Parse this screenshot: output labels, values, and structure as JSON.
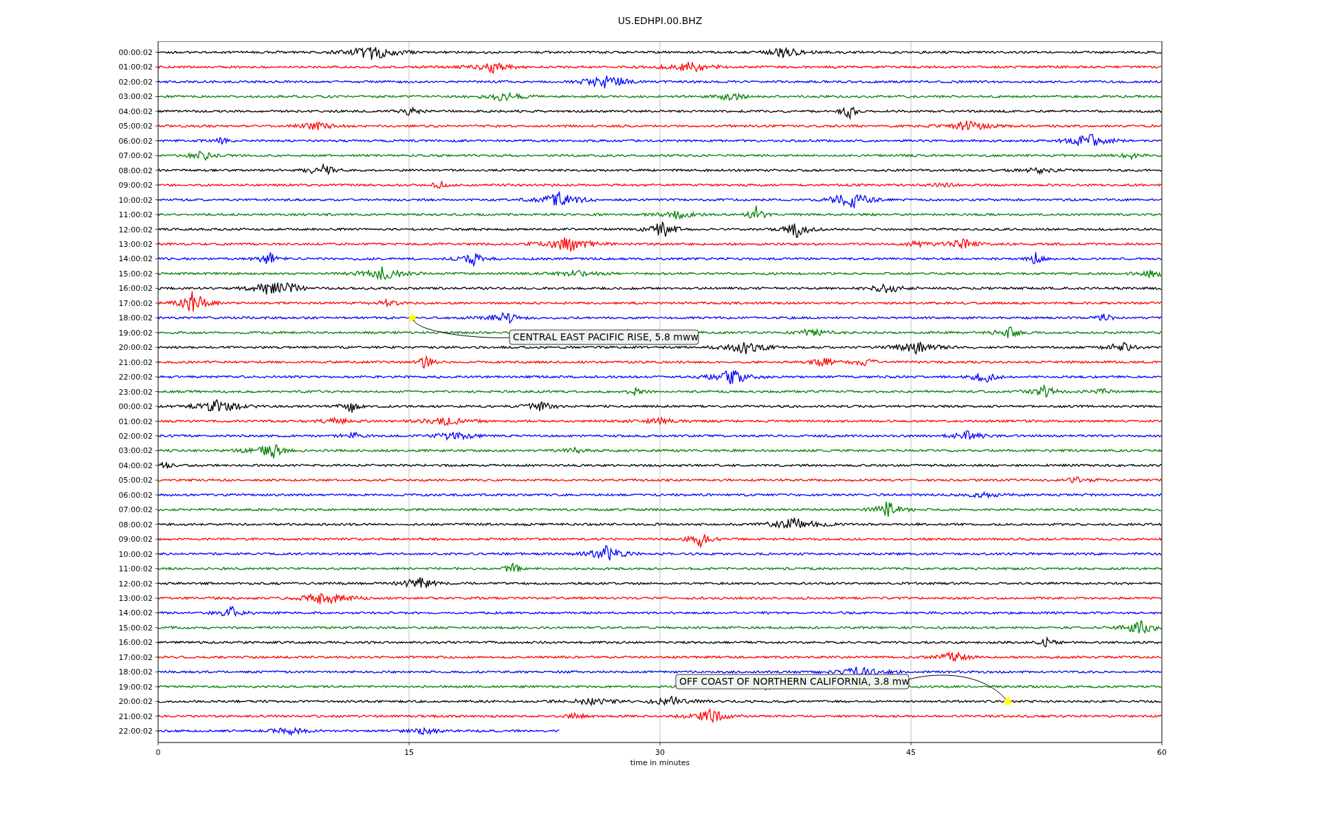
{
  "title": "US.EDHPI.00.BHZ",
  "xlabel": "time in minutes",
  "xticks": [
    "0",
    "15",
    "30",
    "45",
    "60"
  ],
  "rows": [
    {
      "label": "00:00:02",
      "color": "#000000",
      "level": 1
    },
    {
      "label": "01:00:02",
      "color": "#ff0000",
      "level": 1
    },
    {
      "label": "02:00:02",
      "color": "#0000ff",
      "level": 1
    },
    {
      "label": "03:00:02",
      "color": "#008000",
      "level": 1
    },
    {
      "label": "04:00:02",
      "color": "#000000",
      "level": 1
    },
    {
      "label": "05:00:02",
      "color": "#ff0000",
      "level": 1
    },
    {
      "label": "06:00:02",
      "color": "#0000ff",
      "level": 1
    },
    {
      "label": "07:00:02",
      "color": "#008000",
      "level": 1
    },
    {
      "label": "08:00:02",
      "color": "#000000",
      "level": 1
    },
    {
      "label": "09:00:02",
      "color": "#ff0000",
      "level": 1
    },
    {
      "label": "10:00:02",
      "color": "#0000ff",
      "level": 1
    },
    {
      "label": "11:00:02",
      "color": "#008000",
      "level": 1
    },
    {
      "label": "12:00:02",
      "color": "#000000",
      "level": 1
    },
    {
      "label": "13:00:02",
      "color": "#ff0000",
      "level": 1
    },
    {
      "label": "14:00:02",
      "color": "#0000ff",
      "level": 1
    },
    {
      "label": "15:00:02",
      "color": "#008000",
      "level": 1
    },
    {
      "label": "16:00:02",
      "color": "#000000",
      "level": 1
    },
    {
      "label": "17:00:02",
      "color": "#ff0000",
      "level": 1
    },
    {
      "label": "18:00:02",
      "color": "#0000ff",
      "level": 1
    },
    {
      "label": "19:00:02",
      "color": "#008000",
      "level": 1
    },
    {
      "label": "20:00:02",
      "color": "#000000",
      "level": 1
    },
    {
      "label": "21:00:02",
      "color": "#ff0000",
      "level": 1
    },
    {
      "label": "22:00:02",
      "color": "#0000ff",
      "level": 1
    },
    {
      "label": "23:00:02",
      "color": "#008000",
      "level": 1
    },
    {
      "label": "00:00:02",
      "color": "#000000",
      "level": 1
    },
    {
      "label": "01:00:02",
      "color": "#ff0000",
      "level": 1
    },
    {
      "label": "02:00:02",
      "color": "#0000ff",
      "level": 1
    },
    {
      "label": "03:00:02",
      "color": "#008000",
      "level": 1
    },
    {
      "label": "04:00:02",
      "color": "#000000",
      "level": 1
    },
    {
      "label": "05:00:02",
      "color": "#ff0000",
      "level": 1
    },
    {
      "label": "06:00:02",
      "color": "#0000ff",
      "level": 1
    },
    {
      "label": "07:00:02",
      "color": "#008000",
      "level": 1
    },
    {
      "label": "08:00:02",
      "color": "#000000",
      "level": 1
    },
    {
      "label": "09:00:02",
      "color": "#ff0000",
      "level": 1
    },
    {
      "label": "10:00:02",
      "color": "#0000ff",
      "level": 1
    },
    {
      "label": "11:00:02",
      "color": "#008000",
      "level": 1
    },
    {
      "label": "12:00:02",
      "color": "#000000",
      "level": 1
    },
    {
      "label": "13:00:02",
      "color": "#ff0000",
      "level": 1
    },
    {
      "label": "14:00:02",
      "color": "#0000ff",
      "level": 1
    },
    {
      "label": "15:00:02",
      "color": "#008000",
      "level": 1
    },
    {
      "label": "16:00:02",
      "color": "#000000",
      "level": 1
    },
    {
      "label": "17:00:02",
      "color": "#ff0000",
      "level": 1
    },
    {
      "label": "18:00:02",
      "color": "#0000ff",
      "level": 1
    },
    {
      "label": "19:00:02",
      "color": "#008000",
      "level": 1
    },
    {
      "label": "20:00:02",
      "color": "#000000",
      "level": 1
    },
    {
      "label": "21:00:02",
      "color": "#ff0000",
      "level": 1
    },
    {
      "label": "22:00:02",
      "color": "#0000ff",
      "level": 0.4
    }
  ],
  "annotations": [
    {
      "label": "CENTRAL EAST PACIFIC RISE, 5.8 mww"
    },
    {
      "label": "OFF COAST OF NORTHERN CALIFORNIA, 3.8 mw"
    }
  ]
}
